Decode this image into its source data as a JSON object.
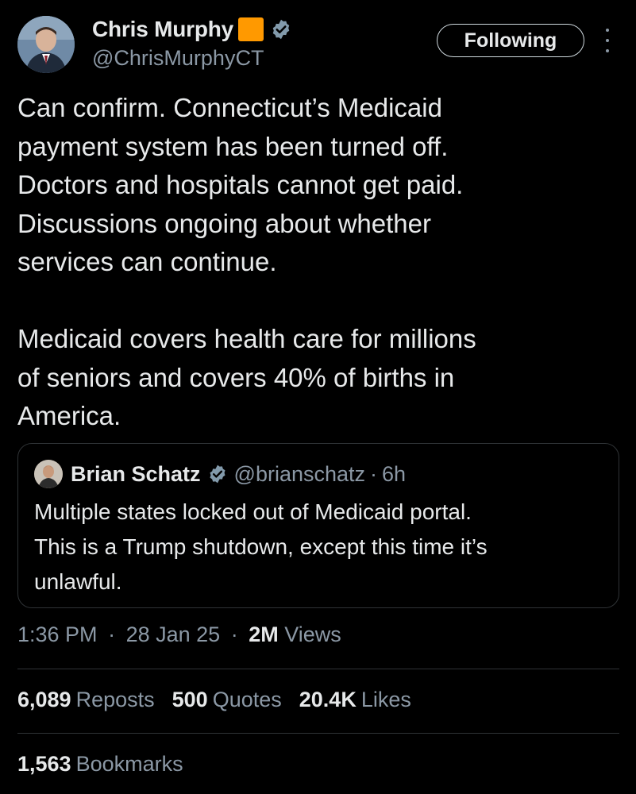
{
  "author": {
    "display_name": "Chris Murphy",
    "handle": "@ChrisMurphyCT",
    "flag_color": "#ff9900",
    "verified_icon": "verified-badge-icon"
  },
  "follow_button": {
    "label": "Following"
  },
  "more_menu": {
    "icon": "more-vertical-icon"
  },
  "tweet": {
    "text": "Can confirm. Connecticut’s Medicaid\npayment system has been turned off.\nDoctors and hospitals cannot get paid.\nDiscussions ongoing about whether\nservices can continue.\n\nMedicaid covers health care for millions\nof seniors and covers 40% of births in\nAmerica."
  },
  "quote": {
    "display_name": "Brian Schatz",
    "handle": "@brianschatz",
    "separator": "·",
    "age": "6h",
    "text": "Multiple states locked out of Medicaid portal.\nThis is a Trump shutdown, except this time it’s\nunlawful."
  },
  "meta": {
    "time": "1:36 PM",
    "separator": "·",
    "date": "28 Jan 25",
    "views_count": "2M",
    "views_label": "Views"
  },
  "stats": {
    "reposts_count": "6,089",
    "reposts_label": "Reposts",
    "quotes_count": "500",
    "quotes_label": "Quotes",
    "likes_count": "20.4K",
    "likes_label": "Likes",
    "bookmarks_count": "1,563",
    "bookmarks_label": "Bookmarks"
  },
  "colors": {
    "background": "#000000",
    "primary_text": "#e7e9ea",
    "secondary_text": "#8b98a5",
    "verified_badge": "#829aab",
    "border": "#2f3336"
  }
}
